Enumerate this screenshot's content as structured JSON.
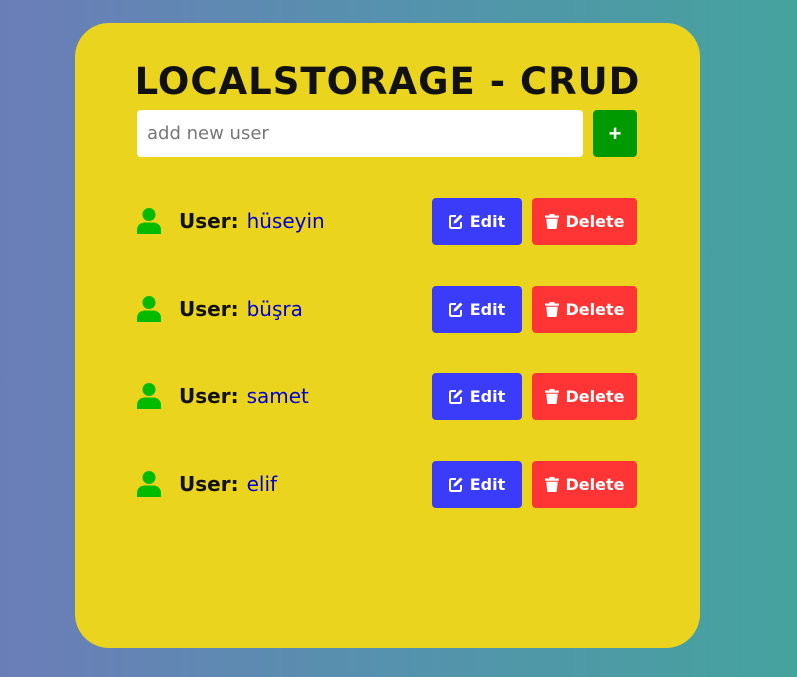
{
  "app": {
    "title": "LOCALSTORAGE - CRUD"
  },
  "input": {
    "placeholder": "add new user",
    "value": "",
    "add_label": "+"
  },
  "users": [
    {
      "prefix": "User:",
      "name": "hüseyin",
      "edit_label": "Edit",
      "delete_label": "Delete"
    },
    {
      "prefix": "User:",
      "name": "büşra",
      "edit_label": "Edit",
      "delete_label": "Delete"
    },
    {
      "prefix": "User:",
      "name": "samet",
      "edit_label": "Edit",
      "delete_label": "Delete"
    },
    {
      "prefix": "User:",
      "name": "elif",
      "edit_label": "Edit",
      "delete_label": "Delete"
    }
  ],
  "icons": {
    "user": "user-icon",
    "edit": "edit-icon",
    "delete": "trash-icon"
  },
  "colors": {
    "card": "#ebd41e",
    "add_button": "#009a00",
    "edit_button": "#3b3bfa",
    "delete_button": "#ff3535",
    "user_icon": "#00bb00",
    "user_name": "#0000d6"
  }
}
